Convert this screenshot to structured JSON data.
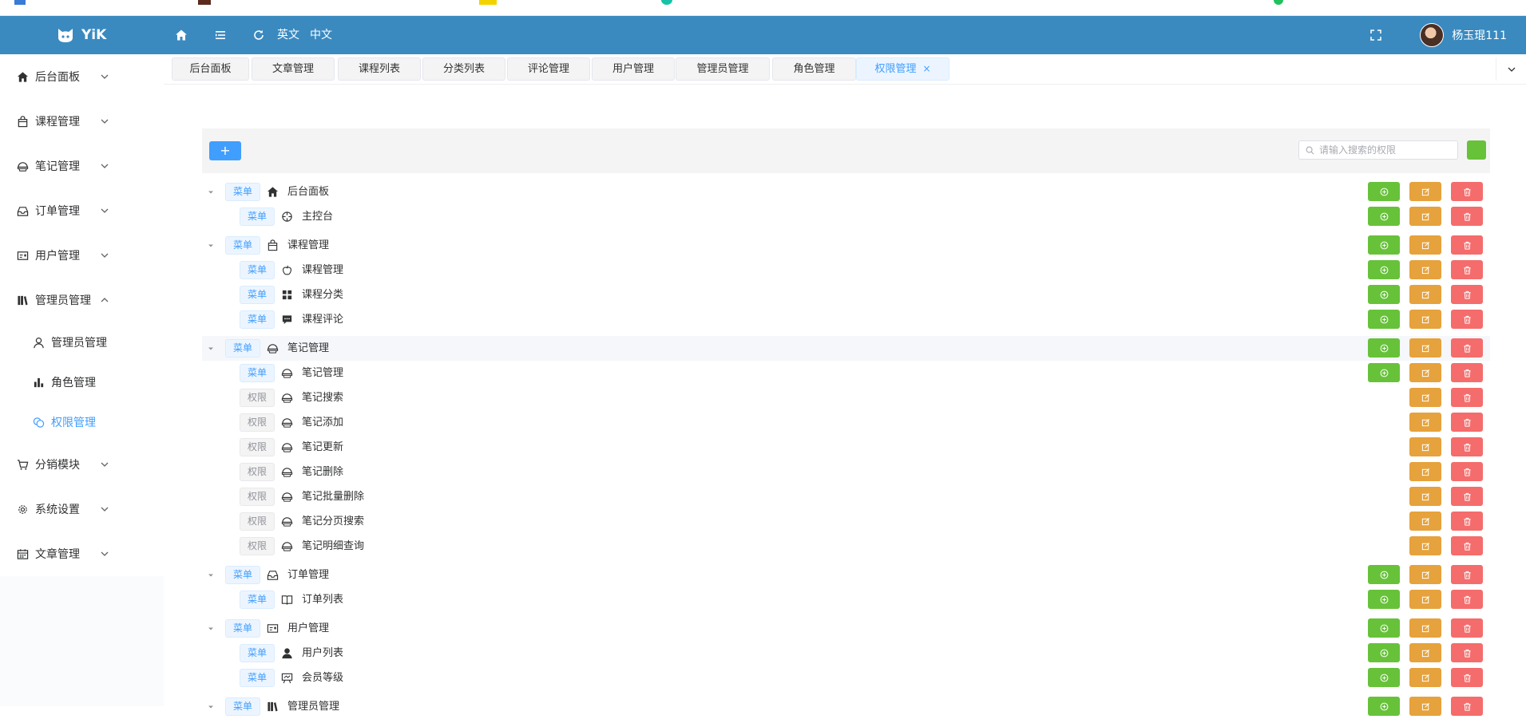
{
  "header": {
    "logo_text": "YiK",
    "lang_en": "英文",
    "lang_zh": "中文",
    "username": "杨玉琨111",
    "bg_color": "#3a8ac0"
  },
  "sidebar": {
    "items": [
      {
        "label": "后台面板",
        "icon": "home-icon"
      },
      {
        "label": "课程管理",
        "icon": "bag-icon"
      },
      {
        "label": "笔记管理",
        "icon": "bowl-icon"
      },
      {
        "label": "订单管理",
        "icon": "inbox-icon"
      },
      {
        "label": "用户管理",
        "icon": "postcard-icon"
      },
      {
        "label": "管理员管理",
        "icon": "collection-icon",
        "expanded": true
      },
      {
        "label": "分销模块",
        "icon": "cart-icon"
      },
      {
        "label": "系统设置",
        "icon": "gear-icon"
      },
      {
        "label": "文章管理",
        "icon": "calendar-icon"
      }
    ],
    "sub_items": [
      {
        "label": "管理员管理",
        "icon": "user-icon"
      },
      {
        "label": "角色管理",
        "icon": "histogram-icon"
      },
      {
        "label": "权限管理",
        "icon": "coin-icon",
        "active": true
      }
    ]
  },
  "tabs": [
    {
      "label": "后台面板"
    },
    {
      "label": "文章管理"
    },
    {
      "label": "课程列表"
    },
    {
      "label": "分类列表"
    },
    {
      "label": "评论管理"
    },
    {
      "label": "用户管理"
    },
    {
      "label": "管理员管理"
    },
    {
      "label": "角色管理"
    },
    {
      "label": "权限管理",
      "active": true,
      "close": "×"
    }
  ],
  "toolbar": {
    "add_label": "+",
    "search_placeholder": "请输入搜索的权限"
  },
  "rows": [
    {
      "level": 0,
      "tag": "菜单",
      "label": "后台面板",
      "icon": "home-icon",
      "caret": true,
      "add": true
    },
    {
      "level": 1,
      "tag": "菜单",
      "label": "主控台",
      "icon": "aim-icon",
      "add": true
    },
    {
      "level": 0,
      "tag": "菜单",
      "label": "课程管理",
      "icon": "bag-icon",
      "caret": true,
      "add": true
    },
    {
      "level": 1,
      "tag": "菜单",
      "label": "课程管理",
      "icon": "apple-icon",
      "add": true
    },
    {
      "level": 1,
      "tag": "菜单",
      "label": "课程分类",
      "icon": "grid-icon",
      "add": true
    },
    {
      "level": 1,
      "tag": "菜单",
      "label": "课程评论",
      "icon": "chat-icon",
      "add": true
    },
    {
      "level": 0,
      "tag": "菜单",
      "label": "笔记管理",
      "icon": "bowl-icon",
      "caret": true,
      "add": true,
      "highlight": true
    },
    {
      "level": 1,
      "tag": "菜单",
      "label": "笔记管理",
      "icon": "bowl-icon",
      "add": true
    },
    {
      "level": 1,
      "tag": "权限",
      "label": "笔记搜索",
      "icon": "bowl-icon",
      "add": false
    },
    {
      "level": 1,
      "tag": "权限",
      "label": "笔记添加",
      "icon": "bowl-icon",
      "add": false
    },
    {
      "level": 1,
      "tag": "权限",
      "label": "笔记更新",
      "icon": "bowl-icon",
      "add": false
    },
    {
      "level": 1,
      "tag": "权限",
      "label": "笔记删除",
      "icon": "bowl-icon",
      "add": false
    },
    {
      "level": 1,
      "tag": "权限",
      "label": "笔记批量删除",
      "icon": "bowl-icon",
      "add": false
    },
    {
      "level": 1,
      "tag": "权限",
      "label": "笔记分页搜索",
      "icon": "bowl-icon",
      "add": false
    },
    {
      "level": 1,
      "tag": "权限",
      "label": "笔记明细查询",
      "icon": "bowl-icon",
      "add": false
    },
    {
      "level": 0,
      "tag": "菜单",
      "label": "订单管理",
      "icon": "inbox-icon",
      "caret": true,
      "add": true
    },
    {
      "level": 1,
      "tag": "菜单",
      "label": "订单列表",
      "icon": "book-icon",
      "add": true
    },
    {
      "level": 0,
      "tag": "菜单",
      "label": "用户管理",
      "icon": "postcard-icon",
      "caret": true,
      "add": true
    },
    {
      "level": 1,
      "tag": "菜单",
      "label": "用户列表",
      "icon": "user-filled-icon",
      "add": true
    },
    {
      "level": 1,
      "tag": "菜单",
      "label": "会员等级",
      "icon": "easel-icon",
      "add": true
    },
    {
      "level": 0,
      "tag": "菜单",
      "label": "管理员管理",
      "icon": "collection-icon",
      "caret": true,
      "add": true
    }
  ],
  "colors": {
    "primary": "#409eff",
    "success": "#67c23a",
    "warning": "#e6a23c",
    "danger": "#f56c6c"
  }
}
